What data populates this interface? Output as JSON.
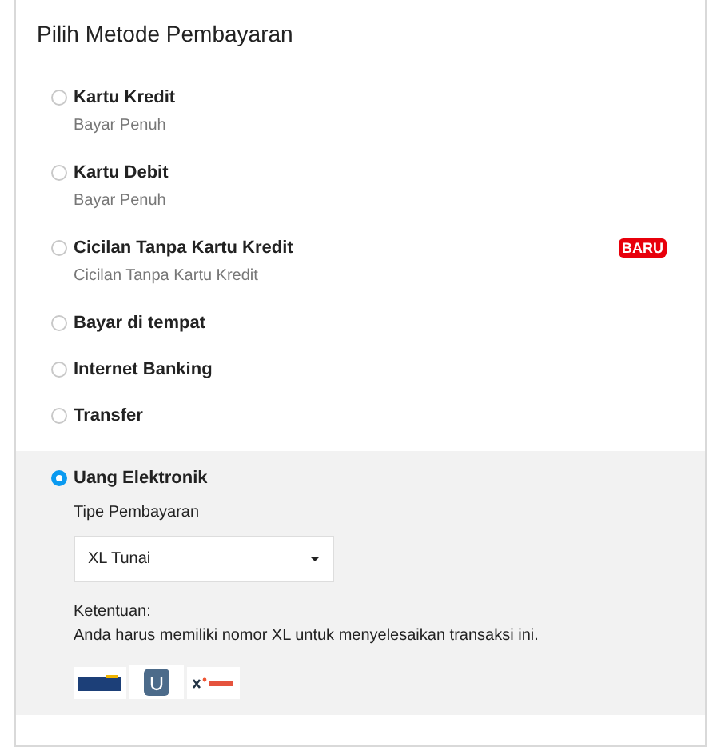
{
  "title": "Pilih Metode Pembayaran",
  "methods": [
    {
      "label": "Kartu Kredit",
      "sublabel": "Bayar Penuh",
      "selected": false
    },
    {
      "label": "Kartu Debit",
      "sublabel": "Bayar Penuh",
      "selected": false
    },
    {
      "label": "Cicilan Tanpa Kartu Kredit",
      "sublabel": "Cicilan Tanpa Kartu Kredit",
      "badge": "BARU",
      "selected": false
    },
    {
      "label": "Bayar di tempat",
      "selected": false
    },
    {
      "label": "Internet Banking",
      "selected": false
    },
    {
      "label": "Transfer",
      "selected": false
    },
    {
      "label": "Uang Elektronik",
      "selected": true,
      "details": {
        "field_label": "Tipe Pembayaran",
        "dropdown_value": "XL Tunai",
        "terms_title": "Ketentuan:",
        "terms_text": "Anda harus memiliki nomor XL untuk menyelesaikan transaksi ini."
      }
    }
  ]
}
